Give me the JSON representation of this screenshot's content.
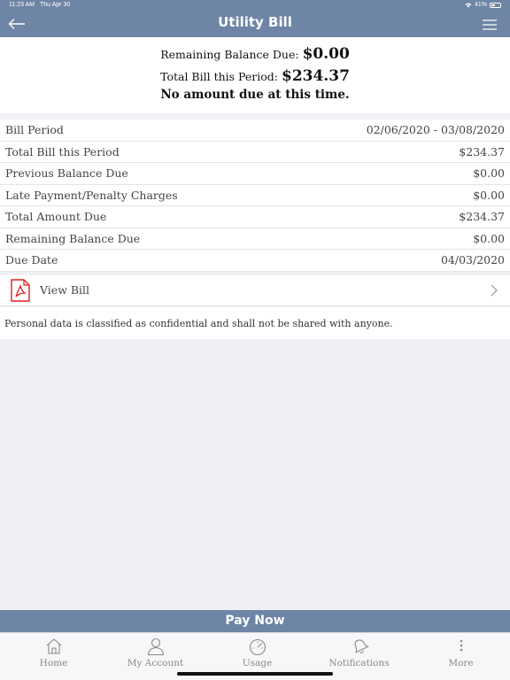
{
  "status_bar": {
    "time": "11:23 AM",
    "date": "Thu Apr 30",
    "battery": "41%"
  },
  "header": {
    "title": "Utility Bill"
  },
  "summary": {
    "remaining_label": "Remaining Balance Due:",
    "remaining_value": "$0.00",
    "total_label": "Total Bill this Period:",
    "total_value": "$234.37",
    "message": "No amount due at this time."
  },
  "details": [
    {
      "label": "Bill Period",
      "value": "02/06/2020 - 03/08/2020"
    },
    {
      "label": "Total Bill this Period",
      "value": "$234.37"
    },
    {
      "label": "Previous Balance Due",
      "value": "$0.00"
    },
    {
      "label": "Late Payment/Penalty Charges",
      "value": "$0.00"
    },
    {
      "label": "Total Amount Due",
      "value": "$234.37"
    },
    {
      "label": "Remaining Balance Due",
      "value": "$0.00"
    },
    {
      "label": "Due Date",
      "value": "04/03/2020"
    }
  ],
  "view_bill": {
    "label": "View Bill",
    "icon": "pdf-icon"
  },
  "disclaimer": "Personal data is classified as confidential and shall not be shared with anyone.",
  "pay_now": "Pay Now",
  "tabs": [
    {
      "label": "Home",
      "icon": "home-icon"
    },
    {
      "label": "My Account",
      "icon": "user-icon"
    },
    {
      "label": "Usage",
      "icon": "gauge-icon"
    },
    {
      "label": "Notifications",
      "icon": "bell-icon"
    },
    {
      "label": "More",
      "icon": "more-icon"
    }
  ],
  "colors": {
    "header": "#6f85a5",
    "pdf_red": "#e02020",
    "tab_inactive": "#888888"
  }
}
